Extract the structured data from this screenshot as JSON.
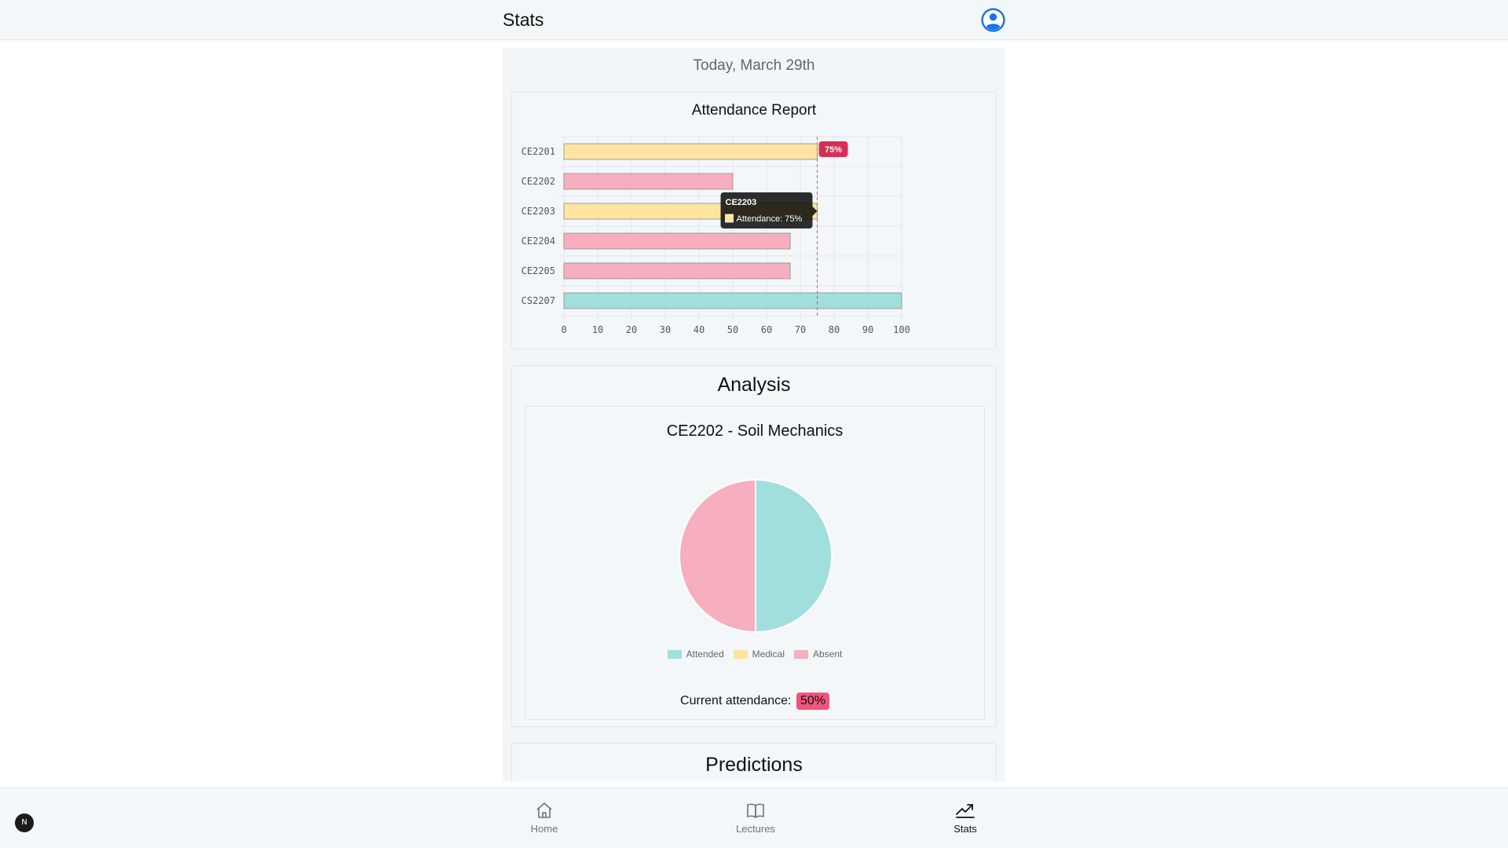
{
  "header": {
    "title": "Stats",
    "profile_icon": "user-circle-icon"
  },
  "date_label": "Today, March 29th",
  "attendance_report": {
    "title": "Attendance Report",
    "threshold_label": "75%",
    "tooltip": {
      "title": "CE2203",
      "label": "Attendance: 75%"
    }
  },
  "analysis": {
    "title": "Analysis",
    "subject": "CE2202 - Soil Mechanics",
    "legend": [
      {
        "label": "Attended",
        "color": "#a1dede"
      },
      {
        "label": "Medical",
        "color": "#fde4a3"
      },
      {
        "label": "Absent",
        "color": "#f7aebf"
      }
    ],
    "current_label": "Current attendance:",
    "current_value": "50%"
  },
  "predictions": {
    "title": "Predictions"
  },
  "nav": {
    "home": "Home",
    "lectures": "Lectures",
    "stats": "Stats"
  },
  "dev_badge": "N",
  "chart_data": [
    {
      "type": "bar",
      "orientation": "horizontal",
      "title": "Attendance Report",
      "categories": [
        "CE2201",
        "CE2202",
        "CE2203",
        "CE2204",
        "CE2205",
        "CS2207"
      ],
      "values": [
        75,
        50,
        75,
        67,
        67,
        100
      ],
      "colors": [
        "#fde4a3",
        "#f7aebf",
        "#fde4a3",
        "#f7aebf",
        "#f7aebf",
        "#a1dede"
      ],
      "xlim": [
        0,
        100
      ],
      "xticks": [
        0,
        10,
        20,
        30,
        40,
        50,
        60,
        70,
        80,
        90,
        100
      ],
      "threshold": 75,
      "grid": true
    },
    {
      "type": "pie",
      "title": "CE2202 - Soil Mechanics",
      "labels": [
        "Attended",
        "Medical",
        "Absent"
      ],
      "values": [
        50,
        0,
        50
      ],
      "colors": [
        "#a1dede",
        "#fde4a3",
        "#f7aebf"
      ]
    }
  ]
}
